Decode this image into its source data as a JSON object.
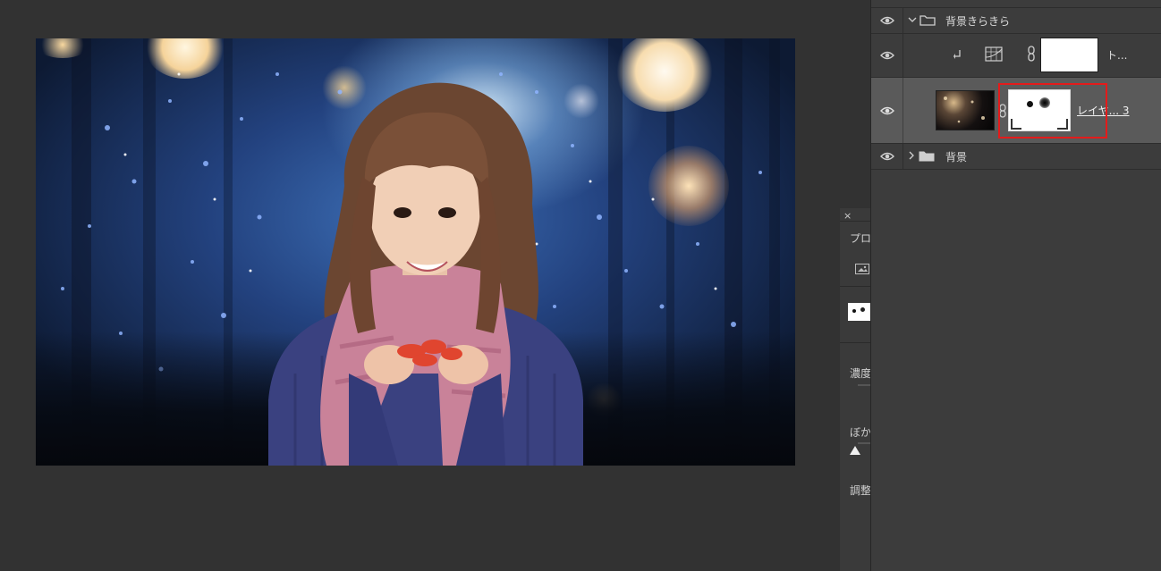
{
  "layers_panel": {
    "rows": [
      {
        "name": "背景きらきら",
        "type": "group",
        "expanded": true
      },
      {
        "name": "ト...",
        "type": "adjustment-clipped"
      },
      {
        "name": "レイヤ... 3",
        "type": "layer-with-mask",
        "selected": true
      },
      {
        "name": "背景",
        "type": "group",
        "expanded": false
      }
    ]
  },
  "properties_panel": {
    "close_label": "×",
    "title_partial": "プロ",
    "density_label_partial": "濃度",
    "feather_label_partial": "ぼか",
    "adjust_label_partial": "調整"
  },
  "colors": {
    "highlight": "#e31b1b",
    "selected_row": "#5a5a5a",
    "panel_bg": "#3c3c3c",
    "workspace_bg": "#323232"
  }
}
